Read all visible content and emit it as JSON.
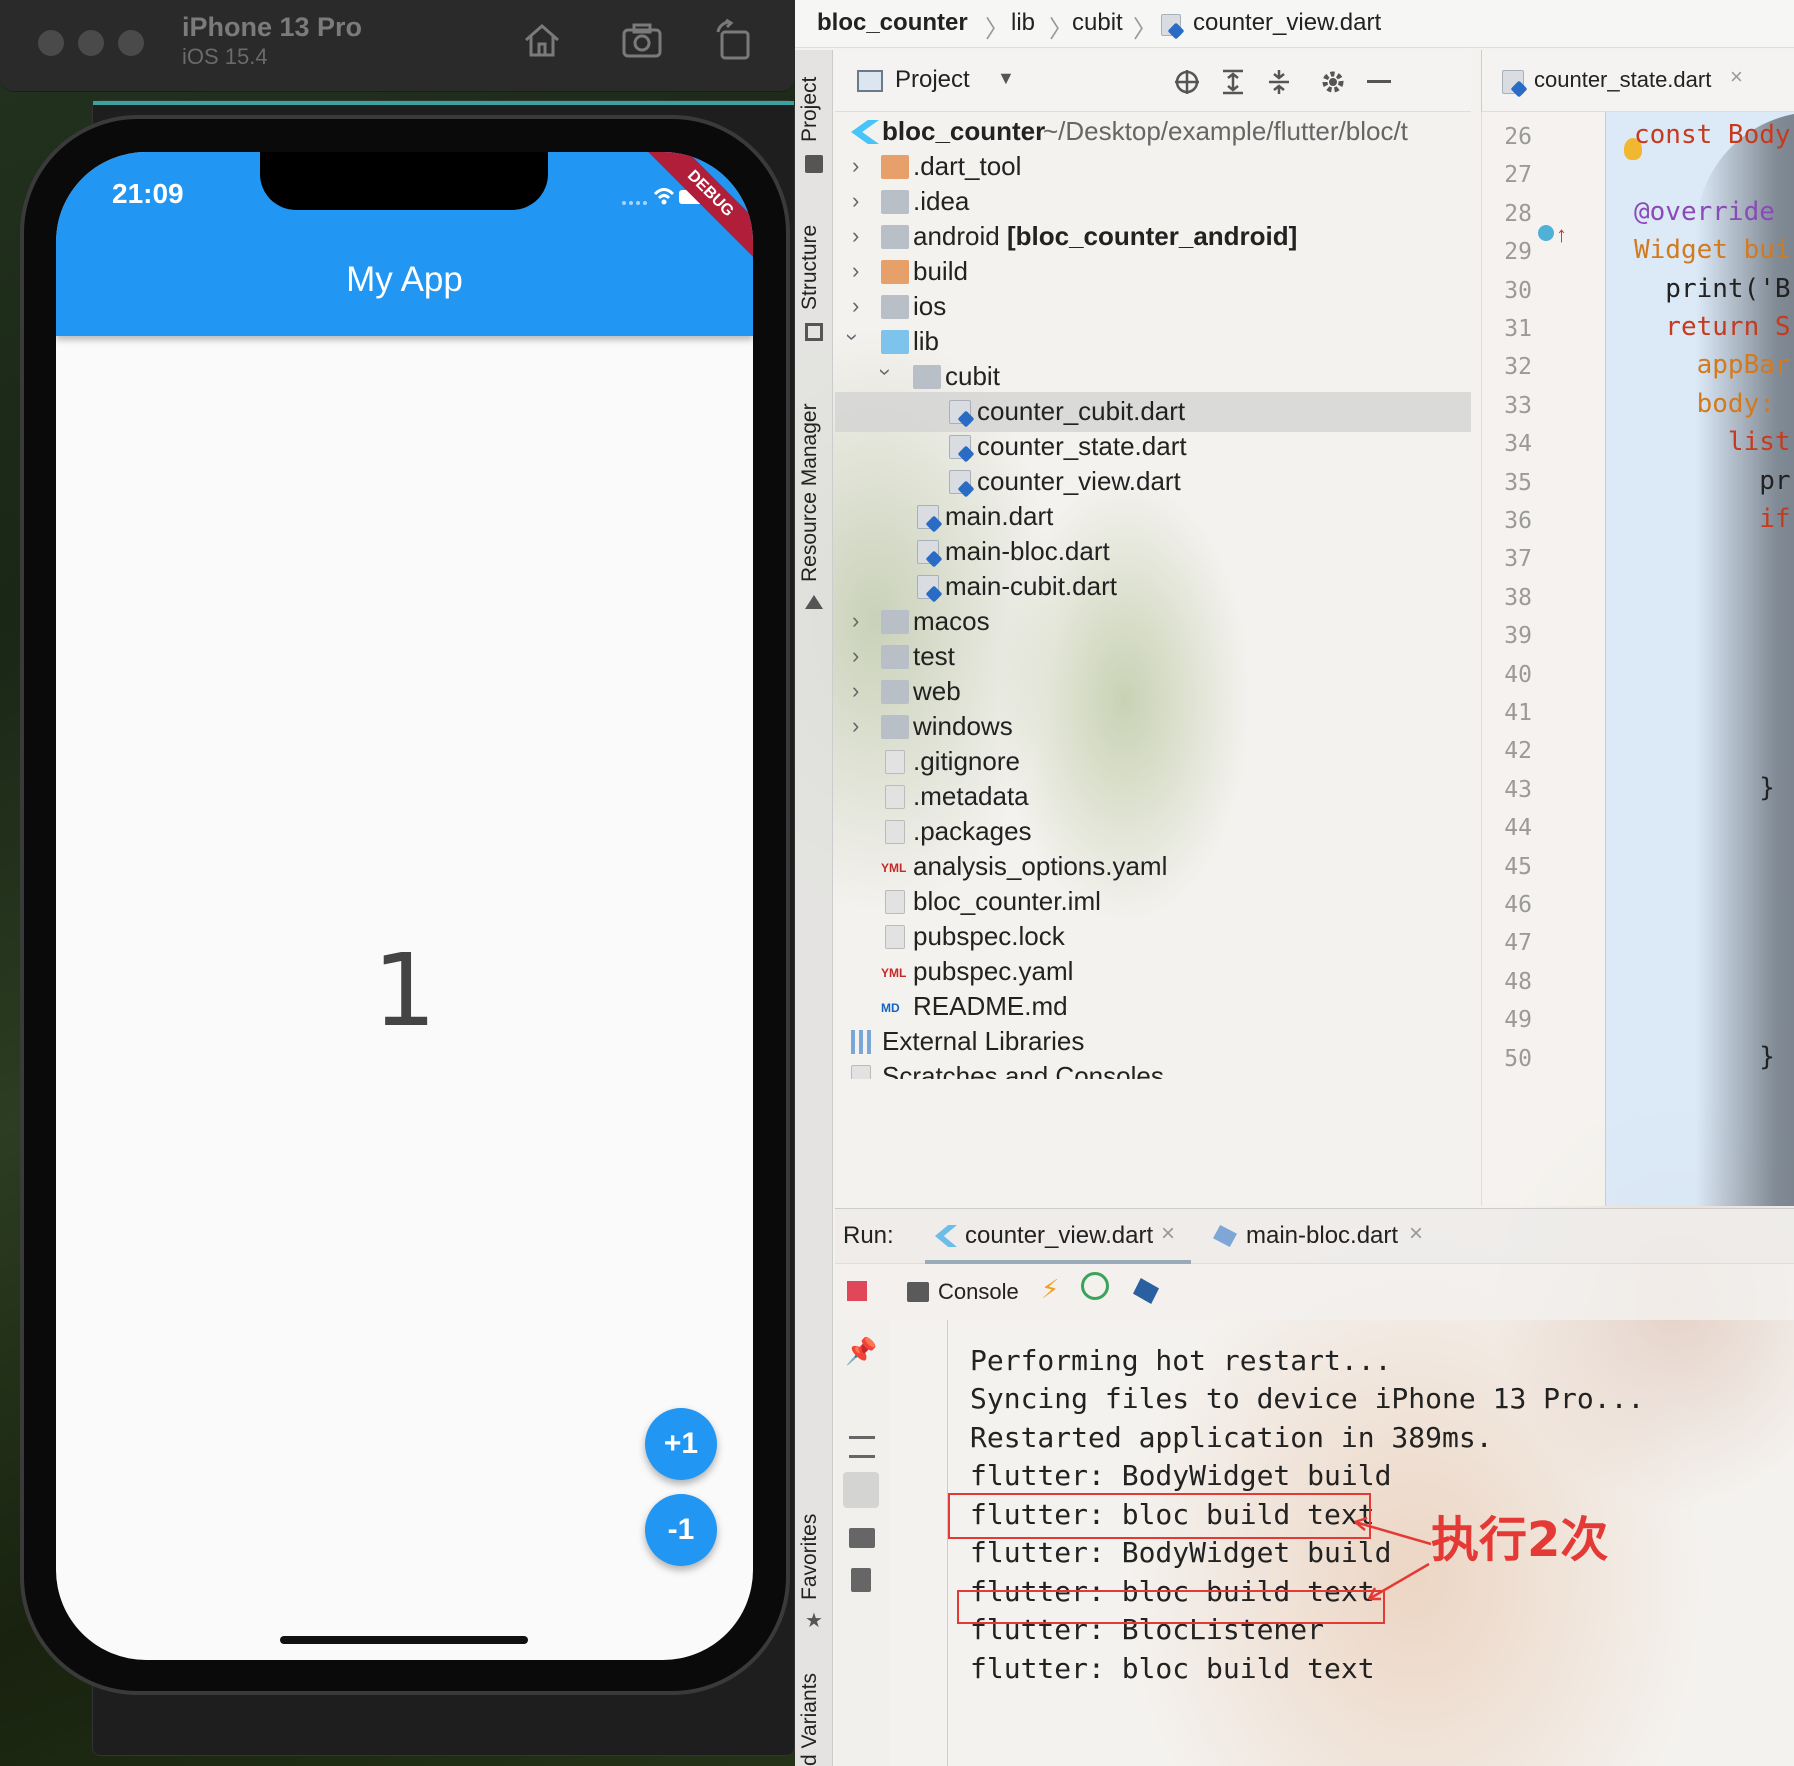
{
  "simulator": {
    "device": "iPhone 13 Pro",
    "os": "iOS 15.4"
  },
  "phone": {
    "time": "21:09",
    "debug_banner": "DEBUG",
    "app_title": "My App",
    "counter": "1",
    "fab_increment": "+1",
    "fab_decrement": "-1",
    "appbar_color": "#2196f3"
  },
  "breadcrumb": [
    "bloc_counter",
    "lib",
    "cubit",
    "counter_view.dart"
  ],
  "project_panel": {
    "header": "Project",
    "root_name": "bloc_counter",
    "root_path": "~/Desktop/example/flutter/bloc/t",
    "items": [
      {
        "label": "bloc_counter",
        "icon": "flutter-module-icon"
      },
      {
        "label": ".dart_tool",
        "icon": "folder-icon"
      },
      {
        "label": ".idea",
        "icon": "folder-icon"
      },
      {
        "label": "android",
        "suffix": "[bloc_counter_android]",
        "icon": "folder-icon"
      },
      {
        "label": "build",
        "icon": "folder-icon"
      },
      {
        "label": "ios",
        "icon": "folder-icon"
      },
      {
        "label": "lib",
        "icon": "folder-icon"
      },
      {
        "label": "cubit",
        "icon": "folder-icon"
      },
      {
        "label": "counter_cubit.dart",
        "icon": "dart-file-icon"
      },
      {
        "label": "counter_state.dart",
        "icon": "dart-file-icon"
      },
      {
        "label": "counter_view.dart",
        "icon": "dart-file-icon"
      },
      {
        "label": "main.dart",
        "icon": "dart-file-icon"
      },
      {
        "label": "main-bloc.dart",
        "icon": "dart-file-icon"
      },
      {
        "label": "main-cubit.dart",
        "icon": "dart-file-icon"
      },
      {
        "label": "macos",
        "icon": "folder-icon"
      },
      {
        "label": "test",
        "icon": "folder-icon"
      },
      {
        "label": "web",
        "icon": "folder-icon"
      },
      {
        "label": "windows",
        "icon": "folder-icon"
      },
      {
        "label": ".gitignore",
        "icon": "text-file-icon"
      },
      {
        "label": ".metadata",
        "icon": "text-file-icon"
      },
      {
        "label": ".packages",
        "icon": "text-file-icon"
      },
      {
        "label": "analysis_options.yaml",
        "icon": "yaml-file-icon"
      },
      {
        "label": "bloc_counter.iml",
        "icon": "iml-file-icon"
      },
      {
        "label": "pubspec.lock",
        "icon": "text-file-icon"
      },
      {
        "label": "pubspec.yaml",
        "icon": "yaml-file-icon"
      },
      {
        "label": "README.md",
        "icon": "md-file-icon"
      },
      {
        "label": "External Libraries",
        "icon": "libraries-icon"
      },
      {
        "label": "Scratches and Consoles",
        "icon": "scratches-icon"
      }
    ]
  },
  "side_tabs": [
    "Project",
    "Structure",
    "Resource Manager",
    "Favorites",
    "d Variants"
  ],
  "editor": {
    "tab": "counter_state.dart",
    "line_numbers": [
      "26",
      "27",
      "28",
      "29",
      "30",
      "31",
      "32",
      "33",
      "34",
      "35",
      "36",
      "37",
      "38",
      "39",
      "40",
      "41",
      "42",
      "43",
      "44",
      "45",
      "46",
      "47",
      "48",
      "49",
      "50"
    ],
    "code_lines": [
      {
        "text": "const Body",
        "cls": "kw",
        "line": 0
      },
      {
        "text": "@override",
        "cls": "ann",
        "line": 2
      },
      {
        "text": "Widget bui",
        "cls": "typ",
        "line": 3
      },
      {
        "text": "  print('B",
        "cls": "pl",
        "line": 4
      },
      {
        "text": "  return S",
        "cls": "kw",
        "line": 5
      },
      {
        "text": "    appBar",
        "cls": "typ",
        "line": 6
      },
      {
        "text": "    body: ",
        "cls": "typ",
        "line": 7
      },
      {
        "text": "      list",
        "cls": "kw",
        "line": 8
      },
      {
        "text": "        pr",
        "cls": "pl",
        "line": 9
      },
      {
        "text": "        if",
        "cls": "kw",
        "line": 10
      },
      {
        "text": "        }",
        "cls": "pl",
        "line": 17
      },
      {
        "text": "        }",
        "cls": "pl",
        "line": 24
      }
    ]
  },
  "run": {
    "label": "Run:",
    "tabs": [
      "counter_view.dart",
      "main-bloc.dart"
    ],
    "console_label": "Console",
    "lines": [
      "Performing hot restart...",
      "Syncing files to device iPhone 13 Pro...",
      "Restarted application in 389ms.",
      "flutter: BodyWidget build",
      "flutter: bloc build text",
      "flutter: BodyWidget build",
      "flutter: bloc build text",
      "flutter: BlocListener",
      "flutter: bloc build text"
    ],
    "annotation": "执行2次",
    "annotation_color": "#e53935"
  }
}
